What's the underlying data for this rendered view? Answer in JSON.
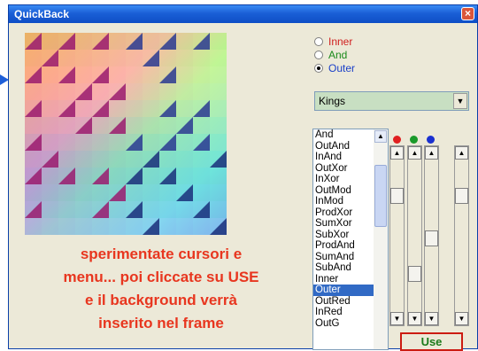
{
  "window": {
    "title": "QuickBack"
  },
  "mode_options": [
    {
      "label": "Inner",
      "color": "#d02020",
      "selected": false
    },
    {
      "label": "And",
      "color": "#1a8a1a",
      "selected": false
    },
    {
      "label": "Outer",
      "color": "#1a3fc8",
      "selected": true
    }
  ],
  "pattern_select": {
    "value": "Kings"
  },
  "operations": {
    "items": [
      "And",
      "OutAnd",
      "InAnd",
      "OutXor",
      "InXor",
      "OutMod",
      "InMod",
      "ProdXor",
      "SumXor",
      "SubXor",
      "ProdAnd",
      "SumAnd",
      "SubAnd",
      "Inner",
      "Outer",
      "OutRed",
      "InRed",
      "OutG"
    ],
    "selected": "Outer"
  },
  "color_channels": [
    {
      "name": "red",
      "color": "#e02020"
    },
    {
      "name": "green",
      "color": "#1a9a2a"
    },
    {
      "name": "blue",
      "color": "#1a30d0"
    }
  ],
  "caption_lines": [
    "sperimentate cursori e",
    "menu... poi cliccate su USE",
    "e il background verrà",
    "inserito nel frame"
  ],
  "use_button": {
    "label": "Use"
  }
}
